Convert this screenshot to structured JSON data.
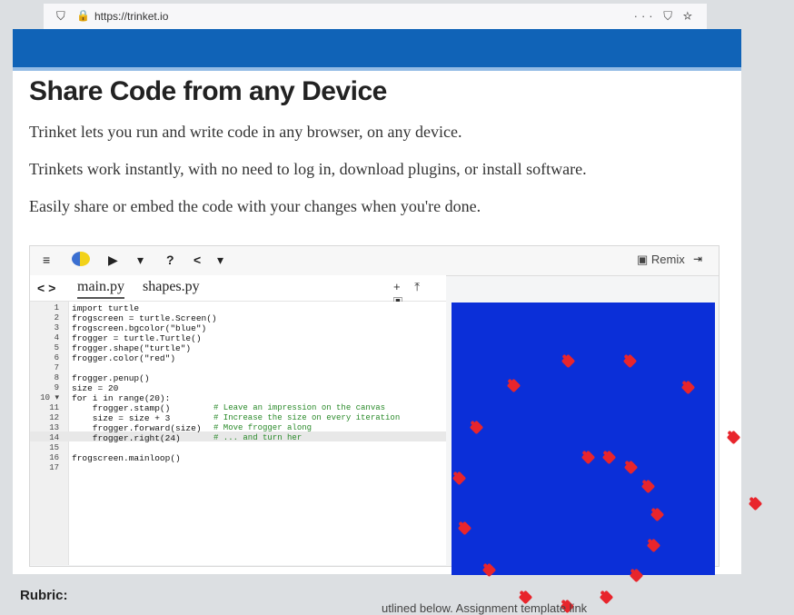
{
  "browser": {
    "url": "https://trinket.io",
    "shield_icon": "shield-icon",
    "lock_icon": "lock-icon",
    "tools": "··· ⛉ ☆"
  },
  "page": {
    "title": "Share Code from any Device",
    "paragraphs": [
      "Trinket lets you run and write code in any browser, on any device.",
      "Trinkets work instantly, with no need to log in, download plugins, or install software.",
      "Easily share or embed the code with your changes when you're done."
    ]
  },
  "trinket": {
    "toolbar": {
      "menu": "≡",
      "run": "▶",
      "dropdown": "▾",
      "help": "?",
      "share": "<",
      "share_dropdown": "▾",
      "remix": "Remix",
      "fullscreen": "⇥"
    },
    "tabs": {
      "nav": "< >",
      "files": [
        "main.py",
        "shapes.py"
      ]
    },
    "file_actions": "+ ⤒ ▣",
    "line_numbers": [
      "1",
      "2",
      "3",
      "4",
      "5",
      "6",
      "7",
      "8",
      "9",
      "10 ▾",
      "11",
      "12",
      "13",
      "14",
      "15",
      "16",
      "17"
    ],
    "code_lines": [
      "import turtle",
      "frogscreen = turtle.Screen()",
      "frogscreen.bgcolor(\"blue\")",
      "frogger = turtle.Turtle()",
      "frogger.shape(\"turtle\")",
      "frogger.color(\"red\")",
      "",
      "frogger.penup()",
      "size = 20",
      "for i in range(20):",
      "    frogger.stamp()",
      "    size = size + 3",
      "    frogger.forward(size)",
      "    frogger.right(24)",
      "",
      "frogscreen.mainloop()",
      ""
    ],
    "comments": [
      "# Leave an impression on the canvas",
      "# Increase the size on every iteration",
      "# Move frogger along",
      "# ... and turn her"
    ],
    "canvas_color": "#0b2fd8",
    "turtle_color": "#e8252c"
  },
  "rubric": {
    "label": "Rubric:",
    "cutoff_text": "utlined below. Assignment template link"
  }
}
